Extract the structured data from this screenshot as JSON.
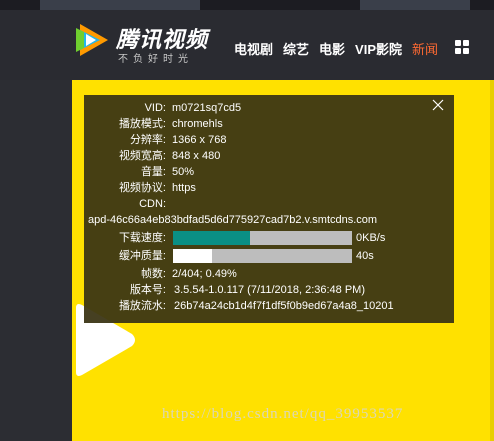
{
  "header": {
    "brand": "腾讯视频",
    "slogan": "不负好时光",
    "nav": [
      "电视剧",
      "综艺",
      "电影",
      "VIP影院",
      "新闻"
    ]
  },
  "stats": {
    "vid": {
      "label": "VID:",
      "value": "m0721sq7cd5"
    },
    "play_mode": {
      "label": "播放模式:",
      "value": "chromehls"
    },
    "resolution": {
      "label": "分辨率:",
      "value": "1366 x 768"
    },
    "video_size": {
      "label": "视频宽高:",
      "value": "848 x 480"
    },
    "volume": {
      "label": "音量:",
      "value": "50%"
    },
    "protocol": {
      "label": "视频协议:",
      "value": "https"
    },
    "cdn": {
      "label": "CDN:",
      "value": "apd-46c66a4eb83bdfad5d6d775927cad7b2.v.smtcdns.com"
    },
    "download_speed": {
      "label": "下载速度:",
      "value": "0KB/s",
      "fill_fraction": 0.43,
      "fill_color": "#0a8f84"
    },
    "buffer": {
      "label": "缓冲质量:",
      "value": "40s",
      "fill_fraction": 0.22,
      "fill_color": "#ffffff"
    },
    "frames": {
      "label": "帧数:",
      "value": "2/404; 0.49%"
    },
    "version": {
      "label": "版本号:",
      "value": "3.5.54-1.0.117 (7/11/2018, 2:36:48 PM)"
    },
    "flow_id": {
      "label": "播放流水:",
      "value": "26b74a24cb1d4f7f1df5f0b9ed67a4a8_10201"
    }
  },
  "watermark": "https://blog.csdn.net/qq_39953537",
  "colors": {
    "video_bg": "#ffe100",
    "nav_active": "#ff6a32",
    "panel_bg": "#3a3414"
  },
  "icons": {
    "logo": "tencent-video-logo",
    "close": "close-icon",
    "menu": "grid-menu-icon",
    "play": "play-icon"
  }
}
